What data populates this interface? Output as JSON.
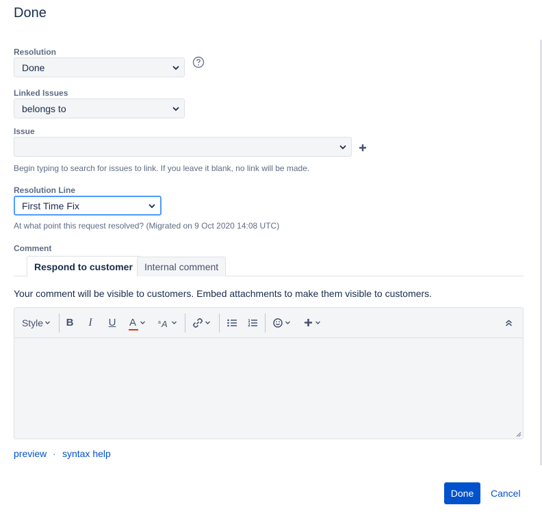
{
  "dialog": {
    "title": "Done"
  },
  "fields": {
    "resolution": {
      "label": "Resolution",
      "value": "Done"
    },
    "linked_issues": {
      "label": "Linked Issues",
      "value": "belongs to"
    },
    "issue": {
      "label": "Issue",
      "value": "",
      "hint": "Begin typing to search for issues to link. If you leave it blank, no link will be made."
    },
    "resolution_line": {
      "label": "Resolution Line",
      "value": "First Time Fix",
      "hint": "At what point this request resolved? (Migrated on 9 Oct 2020 14:08 UTC)"
    }
  },
  "comment": {
    "label": "Comment",
    "tabs": [
      {
        "label": "Respond to customer",
        "active": true
      },
      {
        "label": "Internal comment",
        "active": false
      }
    ],
    "visibility_note": "Your comment will be visible to customers. Embed attachments to make them visible to customers.",
    "toolbar": {
      "style_label": "Style",
      "bold": "B",
      "italic": "I",
      "underline": "U",
      "text_color": "A"
    },
    "links": {
      "preview": "preview",
      "separator": "·",
      "syntax_help": "syntax help"
    }
  },
  "actions": {
    "submit": "Done",
    "cancel": "Cancel"
  },
  "colors": {
    "primary": "#0052cc",
    "text_color_underline": "#de350b",
    "focus_border": "#4c9aff"
  }
}
